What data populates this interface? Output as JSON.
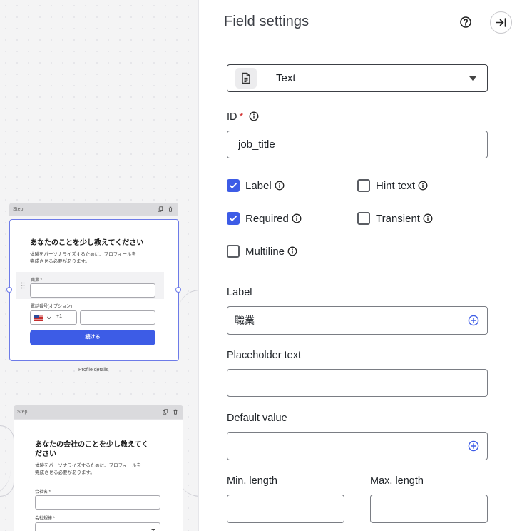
{
  "canvas": {
    "card1": {
      "header": "Step",
      "title": "あなたのことを少し教えてください",
      "description_line1": "体験をパーソナライズするために、プロフィールを",
      "description_line2": "完成させる必要があります。",
      "field1_label": "職業 *",
      "field2_label": "電話番号(オプション)",
      "phone_prefix": "+1",
      "continue_label": "続ける",
      "caption": "Profile details"
    },
    "card2": {
      "header": "Step",
      "title_line1": "あなたの会社のことを少し教えてく",
      "title_line2": "ださい",
      "description_line1": "体験をパーソナライズするために、プロフィールを",
      "description_line2": "完成させる必要があります。",
      "field1_label": "会社名 *",
      "field2_label": "会社規模 *"
    }
  },
  "panel": {
    "title": "Field settings",
    "type_select": {
      "value": "Text"
    },
    "id_field": {
      "label": "ID",
      "required_mark": "*",
      "value": "job_title"
    },
    "checkboxes": {
      "label": {
        "text": "Label",
        "checked": true
      },
      "hint_text": {
        "text": "Hint text",
        "checked": false
      },
      "required": {
        "text": "Required",
        "checked": true
      },
      "transient": {
        "text": "Transient",
        "checked": false
      },
      "multiline": {
        "text": "Multiline",
        "checked": false
      }
    },
    "label_field": {
      "label": "Label",
      "value": "職業"
    },
    "placeholder_field": {
      "label": "Placeholder text",
      "value": ""
    },
    "default_field": {
      "label": "Default value",
      "value": ""
    },
    "min_length": {
      "label": "Min. length",
      "value": ""
    },
    "max_length": {
      "label": "Max. length",
      "value": ""
    }
  },
  "colors": {
    "accent": "#3d5ce6",
    "required_star": "#d23030",
    "selection": "#6d7be8"
  },
  "icons": [
    "copy-icon",
    "trash-icon",
    "help-icon",
    "collapse-panel-icon",
    "document-icon",
    "info-icon",
    "plus-circle-icon",
    "checkmark-icon",
    "drag-handle-icon"
  ]
}
